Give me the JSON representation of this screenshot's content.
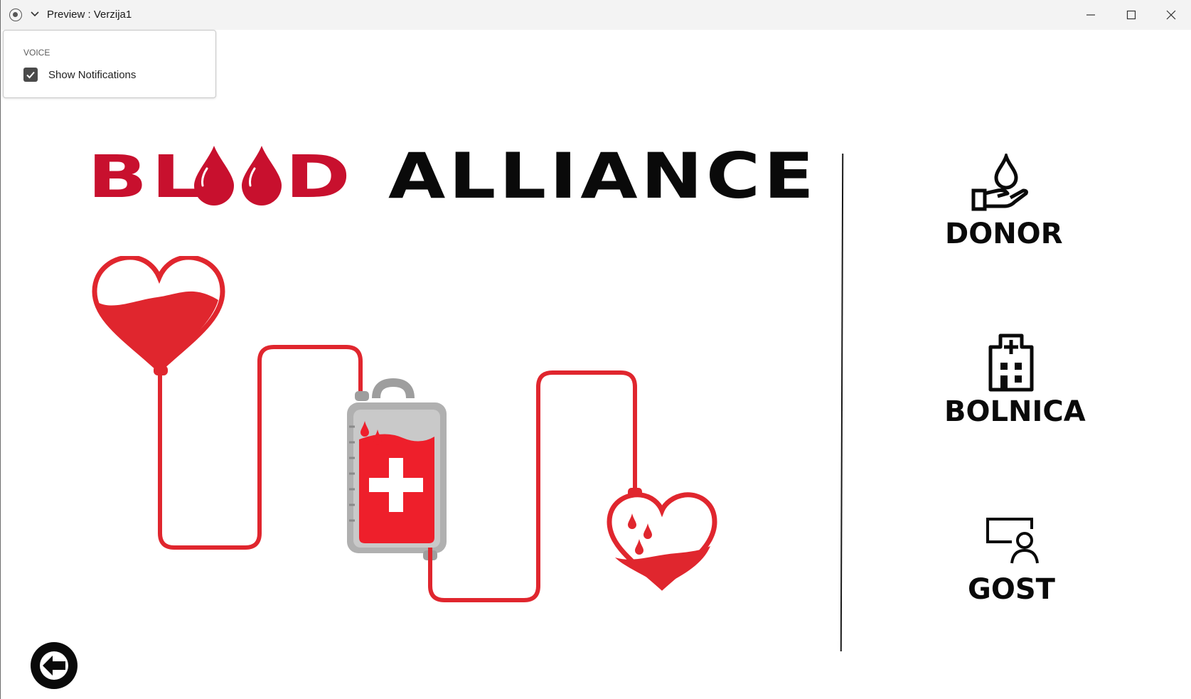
{
  "window": {
    "title": "Preview : Verzija1"
  },
  "voice_panel": {
    "heading": "VOICE",
    "option_label": "Show Notifications",
    "option_checked": true
  },
  "logo": {
    "word1_start": "BL",
    "word1_end": "D",
    "word2": "ALLIANCE",
    "accent_color": "#c8102e"
  },
  "illustration": {
    "icon": "blood-transfusion-illustration"
  },
  "roles": [
    {
      "label": "DONOR",
      "icon": "hand-drop-icon"
    },
    {
      "label": "BOLNICA",
      "icon": "hospital-icon"
    },
    {
      "label": "GOST",
      "icon": "guest-screen-user-icon"
    }
  ],
  "back_button": {
    "icon": "arrow-left-icon"
  }
}
